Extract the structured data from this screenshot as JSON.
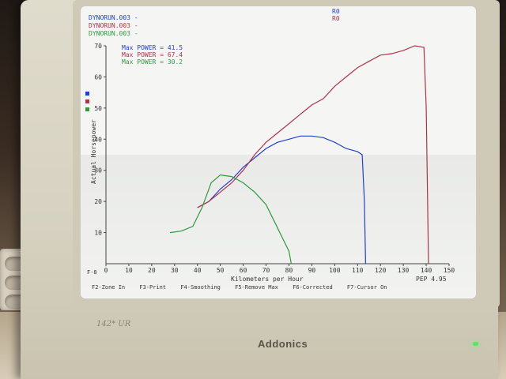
{
  "screen": {
    "runs": [
      {
        "file": "DYNORUN.003",
        "dash": "-",
        "color": "#1f3fd8",
        "tag": "R0"
      },
      {
        "file": "DYNORUN.003",
        "dash": "-",
        "color": "#b0324a",
        "tag": "R0"
      },
      {
        "file": "DYNORUN.003",
        "dash": "-",
        "color": "#2f9a3c",
        "tag": ""
      }
    ],
    "max_power": [
      {
        "label": "Max POWER =",
        "value": "41.5",
        "color": "#1f3fd8"
      },
      {
        "label": "Max POWER =",
        "value": "67.4",
        "color": "#b0324a"
      },
      {
        "label": "Max POWER =",
        "value": "30.2",
        "color": "#2f9a3c"
      }
    ],
    "y_axis_label": "Actual Horsepower",
    "x_axis_label": "Kilometers per Hour",
    "pep": "PEP 4.95",
    "zone_label": "F-8",
    "function_keys": [
      "F2-Zone In",
      "F3-Print",
      "F4-Smoothing",
      "F5-Remove Max",
      "F6-Corrected",
      "F7-Cursor On"
    ]
  },
  "chart_data": {
    "type": "line",
    "title": "",
    "xlabel": "Kilometers per Hour",
    "ylabel": "Actual Horsepower",
    "xlim": [
      0,
      150
    ],
    "ylim": [
      0,
      70
    ],
    "x_ticks": [
      0,
      10,
      20,
      30,
      40,
      50,
      60,
      70,
      80,
      90,
      100,
      110,
      120,
      130,
      140,
      150
    ],
    "y_ticks": [
      10,
      20,
      30,
      40,
      50,
      60,
      70
    ],
    "series": [
      {
        "name": "DYNORUN.003",
        "color": "#1f3fd8",
        "points": [
          [
            40,
            18
          ],
          [
            45,
            20
          ],
          [
            50,
            24
          ],
          [
            55,
            27
          ],
          [
            60,
            31
          ],
          [
            65,
            34
          ],
          [
            70,
            37
          ],
          [
            75,
            39
          ],
          [
            80,
            40
          ],
          [
            85,
            41
          ],
          [
            90,
            41
          ],
          [
            95,
            40.5
          ],
          [
            100,
            39
          ],
          [
            105,
            37
          ],
          [
            110,
            36
          ],
          [
            112,
            35
          ],
          [
            113,
            20
          ],
          [
            113.5,
            0
          ]
        ]
      },
      {
        "name": "DYNORUN.003",
        "color": "#b0324a",
        "points": [
          [
            40,
            18
          ],
          [
            45,
            20
          ],
          [
            50,
            23
          ],
          [
            55,
            26
          ],
          [
            60,
            30
          ],
          [
            65,
            35
          ],
          [
            70,
            39
          ],
          [
            75,
            42
          ],
          [
            80,
            45
          ],
          [
            85,
            48
          ],
          [
            90,
            51
          ],
          [
            95,
            53
          ],
          [
            100,
            57
          ],
          [
            105,
            60
          ],
          [
            110,
            63
          ],
          [
            115,
            65
          ],
          [
            120,
            67
          ],
          [
            125,
            67.5
          ],
          [
            130,
            68.5
          ],
          [
            135,
            70
          ],
          [
            139,
            69.5
          ],
          [
            140,
            50
          ],
          [
            141,
            0
          ]
        ]
      },
      {
        "name": "DYNORUN.003",
        "color": "#2f9a3c",
        "points": [
          [
            28,
            10
          ],
          [
            33,
            10.5
          ],
          [
            38,
            12
          ],
          [
            42,
            18
          ],
          [
            46,
            26
          ],
          [
            50,
            28.5
          ],
          [
            55,
            28
          ],
          [
            60,
            26
          ],
          [
            65,
            23
          ],
          [
            70,
            19
          ],
          [
            74,
            13
          ],
          [
            78,
            7
          ],
          [
            80,
            4
          ],
          [
            81,
            0
          ]
        ]
      }
    ]
  }
}
